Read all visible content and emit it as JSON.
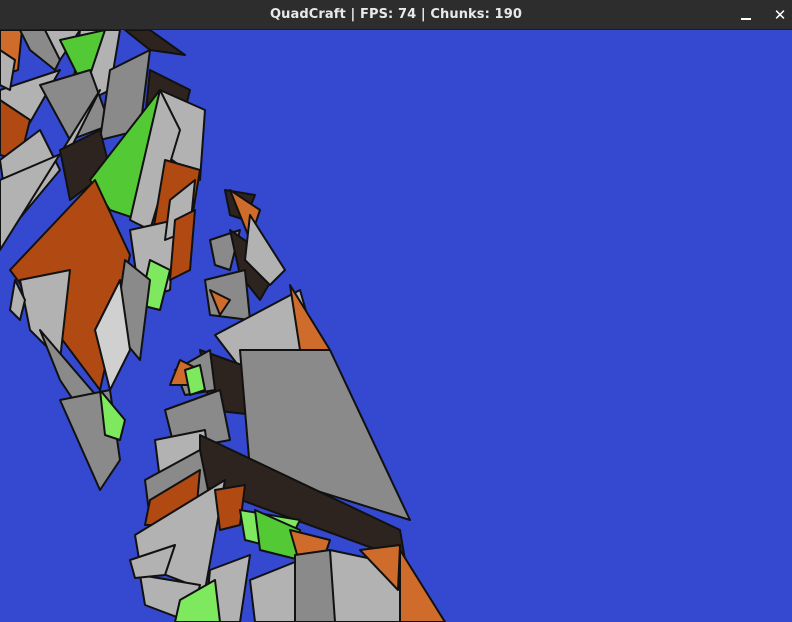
{
  "window": {
    "title": "QuadCraft | FPS: 74 | Chunks: 190",
    "controls": {
      "minimize_icon": "minimize-icon",
      "close_icon": "close-icon",
      "close_glyph": "✕"
    }
  },
  "scene": {
    "sky_color": "#3449cf",
    "palette": {
      "orange": "#b04a12",
      "light_orange": "#cf6c2c",
      "gray": "#8a8a8a",
      "light_gray": "#b2b2b2",
      "white_gray": "#d0d0d0",
      "dark": "#2e241f",
      "green": "#54c936",
      "light_green": "#7ee85e",
      "edge": "#111111"
    }
  }
}
